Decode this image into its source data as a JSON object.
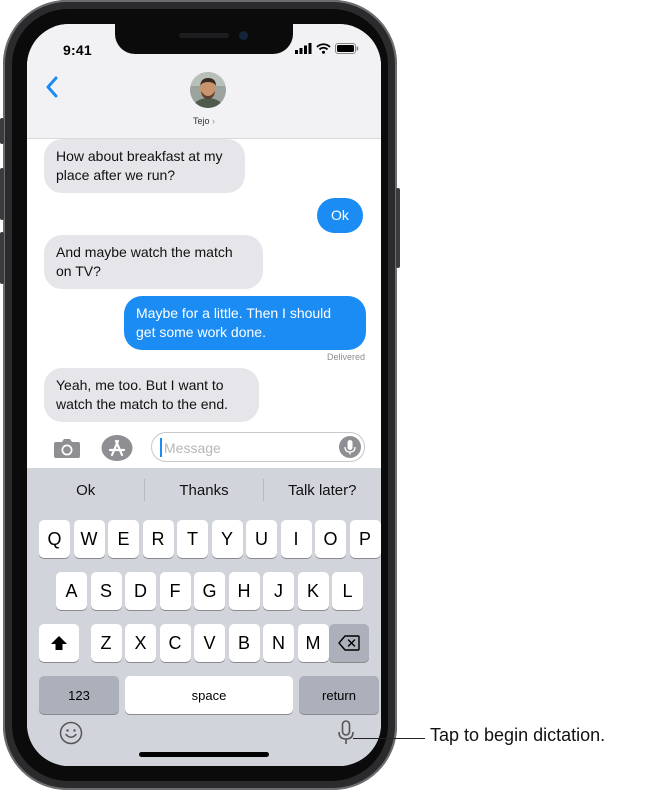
{
  "status": {
    "time": "9:41"
  },
  "header": {
    "contact_name": "Tejo",
    "chevron": "›"
  },
  "messages": [
    {
      "from": "them",
      "text": "How about breakfast at my place after we run?"
    },
    {
      "from": "me",
      "text": "Ok"
    },
    {
      "from": "them",
      "text": "And maybe watch the match on TV?"
    },
    {
      "from": "me",
      "text": "Maybe for a little. Then I should get some work done."
    },
    {
      "from": "them",
      "text": "Yeah, me too. But I want to watch the match to the end."
    }
  ],
  "delivered_label": "Delivered",
  "input": {
    "placeholder": "Message"
  },
  "suggestions": [
    "Ok",
    "Thanks",
    "Talk later?"
  ],
  "keyboard": {
    "row1": [
      "Q",
      "W",
      "E",
      "R",
      "T",
      "Y",
      "U",
      "I",
      "O",
      "P"
    ],
    "row2": [
      "A",
      "S",
      "D",
      "F",
      "G",
      "H",
      "J",
      "K",
      "L"
    ],
    "row3": [
      "Z",
      "X",
      "C",
      "V",
      "B",
      "N",
      "M"
    ],
    "numbers_label": "123",
    "space_label": "space",
    "return_label": "return"
  },
  "callout": "Tap to begin dictation.",
  "icons": [
    "back-chevron-icon",
    "camera-icon",
    "app-store-icon",
    "microphone-icon",
    "shift-icon",
    "delete-icon",
    "emoji-icon",
    "dictation-icon",
    "signal-icon",
    "wifi-icon",
    "battery-icon"
  ],
  "colors": {
    "accent": "#1b8cf4",
    "incoming_bubble": "#e5e5ea",
    "keyboard_bg": "#d1d4da"
  }
}
